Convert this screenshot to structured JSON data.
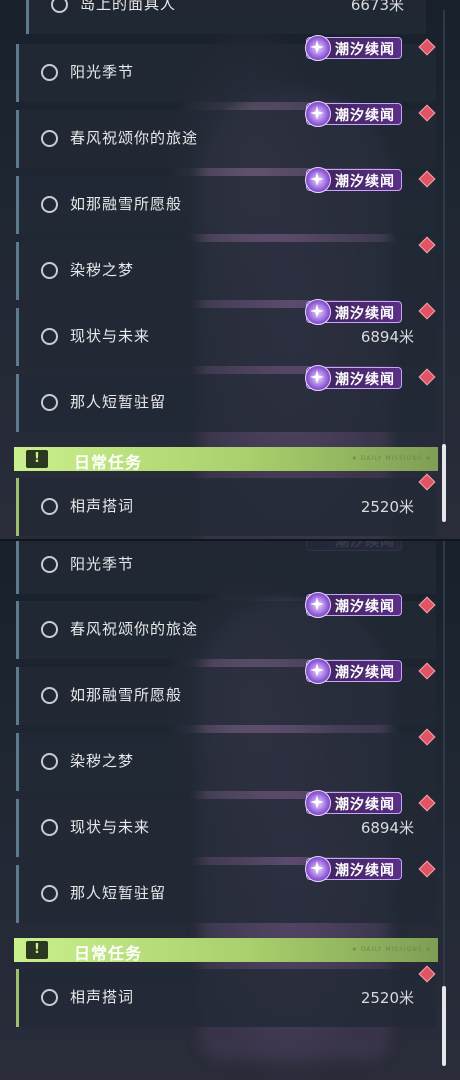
{
  "colors": {
    "accent_daily": "#c9f08d",
    "tag_purple": "#5a2e85",
    "marker_red": "#e05566",
    "row_bar": "#5d7b8f"
  },
  "tag_label": "潮汐续闻",
  "top": {
    "partial_label": "岛上的面具人",
    "partial_dist": "6673米",
    "quests": [
      {
        "label": "阳光季节",
        "dist": ""
      },
      {
        "label": "春风祝颂你的旅途",
        "dist": ""
      },
      {
        "label": "如那融雪所愿般",
        "dist": ""
      },
      {
        "label": "染秽之梦",
        "dist": ""
      },
      {
        "label": "现状与未来",
        "dist": "6894米"
      },
      {
        "label": "那人短暂驻留",
        "dist": ""
      }
    ],
    "daily_section": "日常任务",
    "daily_section_faint": "★ DAILY MISSIONS ★",
    "daily_quest": {
      "label": "相声搭词",
      "dist": "2520米"
    }
  },
  "bottom": {
    "quests": [
      {
        "label": "阳光季节",
        "dist": ""
      },
      {
        "label": "春风祝颂你的旅途",
        "dist": ""
      },
      {
        "label": "如那融雪所愿般",
        "dist": ""
      },
      {
        "label": "染秽之梦",
        "dist": ""
      },
      {
        "label": "现状与未来",
        "dist": "6894米"
      },
      {
        "label": "那人短暂驻留",
        "dist": ""
      }
    ],
    "daily_section": "日常任务",
    "daily_section_faint": "★ DAILY MISSIONS ★",
    "daily_quest": {
      "label": "相声搭词",
      "dist": "2520米"
    }
  },
  "icons": {
    "quest_marker": "circle-icon",
    "tag_emblem": "tidal-sparkle-icon",
    "waypoint": "diamond-marker-icon",
    "section_icon": "exclamation-icon"
  }
}
